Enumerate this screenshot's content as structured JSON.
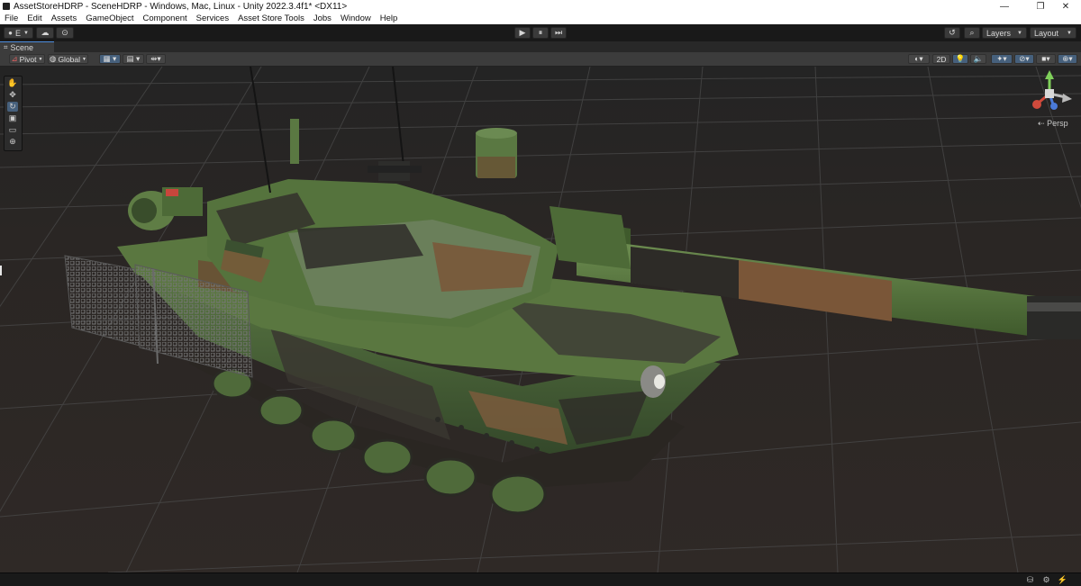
{
  "window": {
    "title": "AssetStoreHDRP - SceneHDRP - Windows, Mac, Linux - Unity 2022.3.4f1* <DX11>",
    "controls": {
      "minimize": "—",
      "restore": "❐",
      "close": "✕"
    }
  },
  "menu": [
    "File",
    "Edit",
    "Assets",
    "GameObject",
    "Component",
    "Services",
    "Asset Store Tools",
    "Jobs",
    "Window",
    "Help"
  ],
  "toolbar": {
    "account_label": "E",
    "account_icon": "account-circle-icon",
    "cloud_icon": "cloud-icon",
    "collab_icon": "collab-icon",
    "play_icon": "▶",
    "pause_icon": "⏸",
    "step_icon": "⏭",
    "history_icon": "↺",
    "search_icon": "⌕",
    "layers_label": "Layers",
    "layout_label": "Layout"
  },
  "scene_tab": {
    "label": "Scene",
    "icon": "⌗"
  },
  "scene_toolbar": {
    "pivot_label": "Pivot",
    "global_label": "Global",
    "twod_label": "2D",
    "accent_color": "#46607c"
  },
  "tools": [
    {
      "name": "hand",
      "glyph": "✋"
    },
    {
      "name": "move",
      "glyph": "✥"
    },
    {
      "name": "rotate",
      "glyph": "↻"
    },
    {
      "name": "scale",
      "glyph": "▣"
    },
    {
      "name": "rect",
      "glyph": "▭"
    },
    {
      "name": "transform",
      "glyph": "⊕"
    }
  ],
  "gizmo": {
    "view_label": "Persp"
  }
}
